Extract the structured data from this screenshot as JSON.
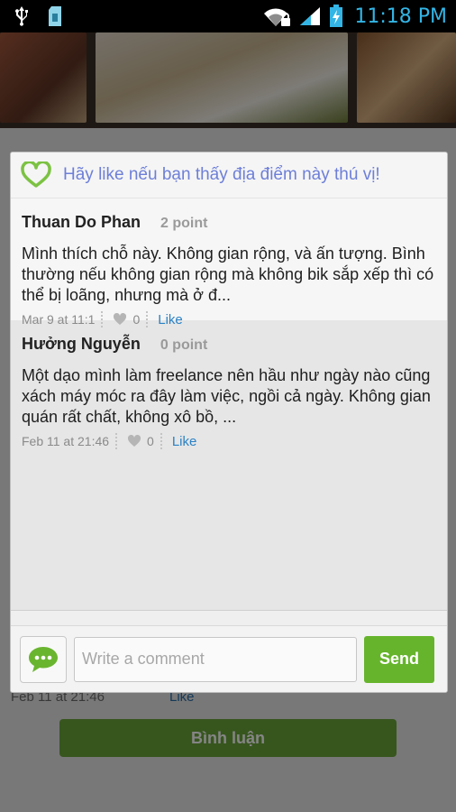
{
  "status_bar": {
    "time": "11:18 PM",
    "icons": [
      "usb-icon",
      "sd-card-icon",
      "wifi-lock-icon",
      "signal-icon",
      "battery-charging-icon"
    ]
  },
  "background": {
    "last_date": "Feb 11 at 21:46",
    "last_like": "Like",
    "comment_button": "Bình luận"
  },
  "dialog": {
    "title": "Hãy like nếu bạn thấy địa điểm này thú vị!",
    "comments": [
      {
        "name": "Thuan Do Phan",
        "points": "2 point",
        "text": "Mình thích chỗ này. Không gian rộng, và ấn tượng. Bình thường nếu không gian rộng mà không bik sắp xếp thì có thể bị loãng, nhưng mà ở đ...",
        "date": "Mar 9 at 11:1",
        "likes": "0",
        "like_label": "Like"
      },
      {
        "name": "Hưởng Nguyễn",
        "points": "0 point",
        "text": "Một dạo mình làm freelance nên hầu như ngày nào cũng xách máy móc ra đây làm việc, ngồi cả ngày. Không gian quán rất chất, không xô bồ, ...",
        "date": "Feb 11 at 21:46",
        "likes": "0",
        "like_label": "Like"
      }
    ],
    "input": {
      "placeholder": "Write a comment",
      "value": ""
    },
    "send_label": "Send"
  },
  "colors": {
    "accent_green": "#66b42c",
    "title_blue": "#6d7fd8",
    "link_blue": "#2b82c5",
    "status_time": "#33b5e5"
  }
}
